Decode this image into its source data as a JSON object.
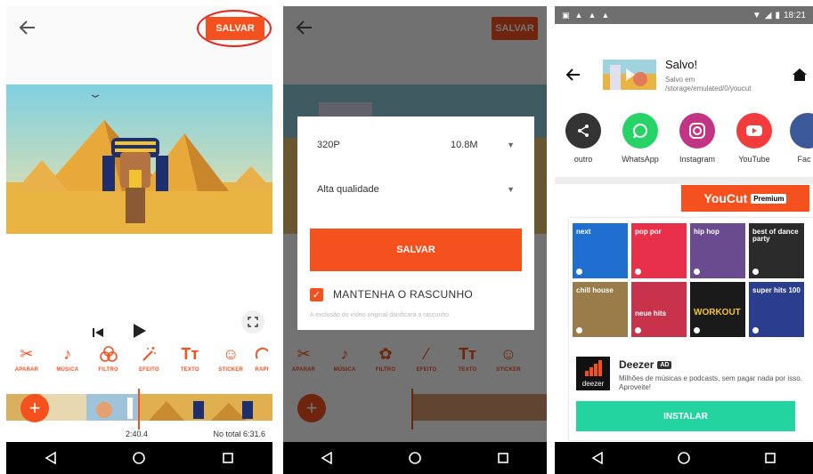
{
  "screen1": {
    "save_label": "SALVAR",
    "tools": [
      {
        "label": "APARAR",
        "icon": "scissors-icon"
      },
      {
        "label": "MÚSICA",
        "icon": "music-note-icon"
      },
      {
        "label": "FILTRO",
        "icon": "filter-icon"
      },
      {
        "label": "EFEITO",
        "icon": "magic-wand-icon"
      },
      {
        "label": "TEXTO",
        "icon": "text-icon"
      },
      {
        "label": "STICKER",
        "icon": "smiley-icon"
      },
      {
        "label": "RAPI",
        "icon": "speed-icon"
      }
    ],
    "current_time": "2:40.4",
    "total_time": "No total 6:31.6"
  },
  "screen2": {
    "resolution": "320P",
    "size": "10.8M",
    "quality": "Alta qualidade",
    "save_label": "SALVAR",
    "keep_draft_label": "MANTENHA O RASCUNHO",
    "keep_draft_checked": true,
    "draft_note": "A exclusão do vídeo original danificará o rascunho."
  },
  "screen3": {
    "status_time": "18:21",
    "saved_title": "Salvo!",
    "saved_path": "Salvo em /storage/emulated/0/youcut",
    "share_targets": [
      {
        "label": "outro",
        "color": "#333333",
        "icon": "share-icon"
      },
      {
        "label": "WhatsApp",
        "color": "#25d366",
        "icon": "whatsapp-icon"
      },
      {
        "label": "Instagram",
        "color": "#c13584",
        "icon": "instagram-icon"
      },
      {
        "label": "YouTube",
        "color": "#f23b3b",
        "icon": "youtube-icon"
      },
      {
        "label": "Fac",
        "color": "#3b5998",
        "icon": "facebook-icon"
      }
    ],
    "premium_brand": "YouCut",
    "premium_badge": "Premium",
    "ad_tiles": [
      {
        "title": "next",
        "color": "#1f6fd1"
      },
      {
        "title": "pop por",
        "color": "#e8304a"
      },
      {
        "title": "hip hop",
        "color": "#6a4b8f"
      },
      {
        "title": "best of dance party",
        "color": "#2b2b2b"
      },
      {
        "title": "chill house",
        "color": "#9a7b4a"
      },
      {
        "title": "neue hits",
        "color": "#c8324a"
      },
      {
        "title": "WORKOUT",
        "color": "#1a1a1a"
      },
      {
        "title": "super hits 100",
        "color": "#2a3d8f"
      }
    ],
    "ad_name": "Deezer",
    "ad_badge": "AD",
    "ad_description": "Milhões de músicas e podcasts, sem pagar nada por isso. Aproveite!",
    "install_label": "INSTALAR",
    "deezer_logo_text": "deezer"
  }
}
